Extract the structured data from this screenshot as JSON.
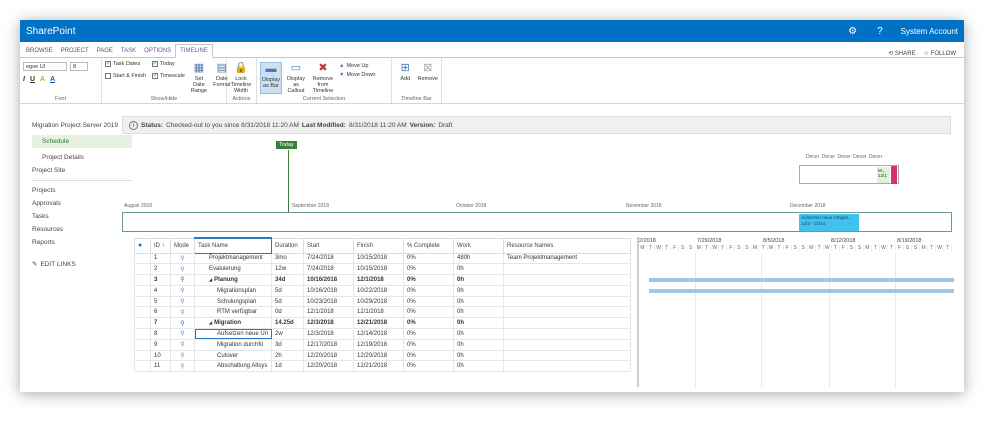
{
  "suitebar": {
    "brand": "SharePoint",
    "gear": "gear-icon",
    "help": "?",
    "account": "System Account"
  },
  "tabs": {
    "items": [
      "BROWSE",
      "PROJECT",
      "PAGE",
      "TASK",
      "OPTIONS",
      "TIMELINE"
    ],
    "share": "SHARE",
    "follow": "FOLLOW"
  },
  "ribbon": {
    "font_name": "egoe UI",
    "font_size": "8",
    "group_font": "Font",
    "group_showhide": "Show/Hide",
    "group_actions": "Actions",
    "group_current": "Current Selection",
    "group_timelinebar": "Timeline Bar",
    "task_dates": "Task Dates",
    "today": "Today",
    "start_finish": "Start & Finish",
    "timescale": "Timescale",
    "set_date_range": "Set Date Range",
    "date_format": "Date Format",
    "lock_timeline": "Lock Timeline Width",
    "display_bar": "Display as Bar",
    "display_callout": "Display as Callout",
    "remove_timeline": "Remove from Timeline",
    "move_up": "Move Up",
    "move_down": "Move Down",
    "add": "Add",
    "remove": "Remove"
  },
  "leftnav": {
    "project": "Migration Project Server 2019",
    "schedule": "Schedule",
    "details": "Project Details",
    "site": "Project Site",
    "projects": "Projects",
    "approvals": "Approvals",
    "tasks": "Tasks",
    "resources": "Resources",
    "reports": "Reports",
    "edit_links": "EDIT LINKS"
  },
  "status": {
    "label": "Status:",
    "text": "Checked-out to you since 8/31/2018 11:20 AM",
    "modified_label": "Last Modified:",
    "modified": "8/31/2018 11:20 AM",
    "version_label": "Version:",
    "version": "Draft"
  },
  "timeline": {
    "today": "Today",
    "dec_labels": "Decer Decer Decer Decer Decer",
    "ms_text": "M... 12/1",
    "months": [
      "August 2018",
      "September 2018",
      "October 2018",
      "November 2018",
      "December 2018"
    ],
    "bar_task": "Aufsetzen neue Umgeb...",
    "bar_dates": "12/3 - 12/14"
  },
  "grid": {
    "headers": [
      "",
      "ID ↑",
      "Mode",
      "Task Name",
      "Duration",
      "Start",
      "Finish",
      "% Complete",
      "Work",
      "Resource Names"
    ],
    "rows": [
      {
        "id": "1",
        "name": "Projektmanagement",
        "duration": "3mo",
        "start": "7/24/2018",
        "finish": "10/15/2018",
        "pct": "0%",
        "work": "480h",
        "res": "Team Projektmanagement"
      },
      {
        "id": "2",
        "name": "Evaluierung",
        "duration": "12w",
        "start": "7/24/2018",
        "finish": "10/15/2018",
        "pct": "0%",
        "work": "0h",
        "res": ""
      },
      {
        "id": "3",
        "name": "Planung",
        "duration": "34d",
        "start": "10/16/2018",
        "finish": "12/1/2018",
        "pct": "0%",
        "work": "0h",
        "res": ""
      },
      {
        "id": "4",
        "name": "Migrationsplan",
        "duration": "5d",
        "start": "10/16/2018",
        "finish": "10/22/2018",
        "pct": "0%",
        "work": "0h",
        "res": ""
      },
      {
        "id": "5",
        "name": "Schulungsplan",
        "duration": "5d",
        "start": "10/23/2018",
        "finish": "10/29/2018",
        "pct": "0%",
        "work": "0h",
        "res": ""
      },
      {
        "id": "6",
        "name": "RTM verfügbar",
        "duration": "0d",
        "start": "12/1/2018",
        "finish": "12/1/2018",
        "pct": "0%",
        "work": "0h",
        "res": ""
      },
      {
        "id": "7",
        "name": "Migration",
        "duration": "14.25d",
        "start": "12/3/2018",
        "finish": "12/21/2018",
        "pct": "0%",
        "work": "0h",
        "res": ""
      },
      {
        "id": "8",
        "name": "Aufsetzen neue Un",
        "duration": "2w",
        "start": "12/3/2018",
        "finish": "12/14/2018",
        "pct": "0%",
        "work": "0h",
        "res": ""
      },
      {
        "id": "9",
        "name": "Migration durchfü",
        "duration": "3d",
        "start": "12/17/2018",
        "finish": "12/19/2018",
        "pct": "0%",
        "work": "0h",
        "res": ""
      },
      {
        "id": "10",
        "name": "Cutover",
        "duration": "2h",
        "start": "12/20/2018",
        "finish": "12/20/2018",
        "pct": "0%",
        "work": "0h",
        "res": ""
      },
      {
        "id": "11",
        "name": "Abschaltung Altsys",
        "duration": "1d",
        "start": "12/20/2018",
        "finish": "12/21/2018",
        "pct": "0%",
        "work": "0h",
        "res": ""
      }
    ]
  },
  "gantt": {
    "weeks": [
      "2/2018",
      "7/29/2018",
      "8/5/2018",
      "8/12/2018",
      "8/19/2018"
    ],
    "days": [
      "M",
      "T",
      "W",
      "T",
      "F",
      "S",
      "S",
      "M",
      "T",
      "W",
      "T",
      "F",
      "S",
      "S",
      "M",
      "T",
      "W",
      "T",
      "F",
      "S",
      "S",
      "M",
      "T",
      "W",
      "T",
      "F",
      "S",
      "S",
      "M",
      "T",
      "W",
      "T",
      "F",
      "S",
      "S",
      "M",
      "T",
      "W",
      "T"
    ]
  }
}
